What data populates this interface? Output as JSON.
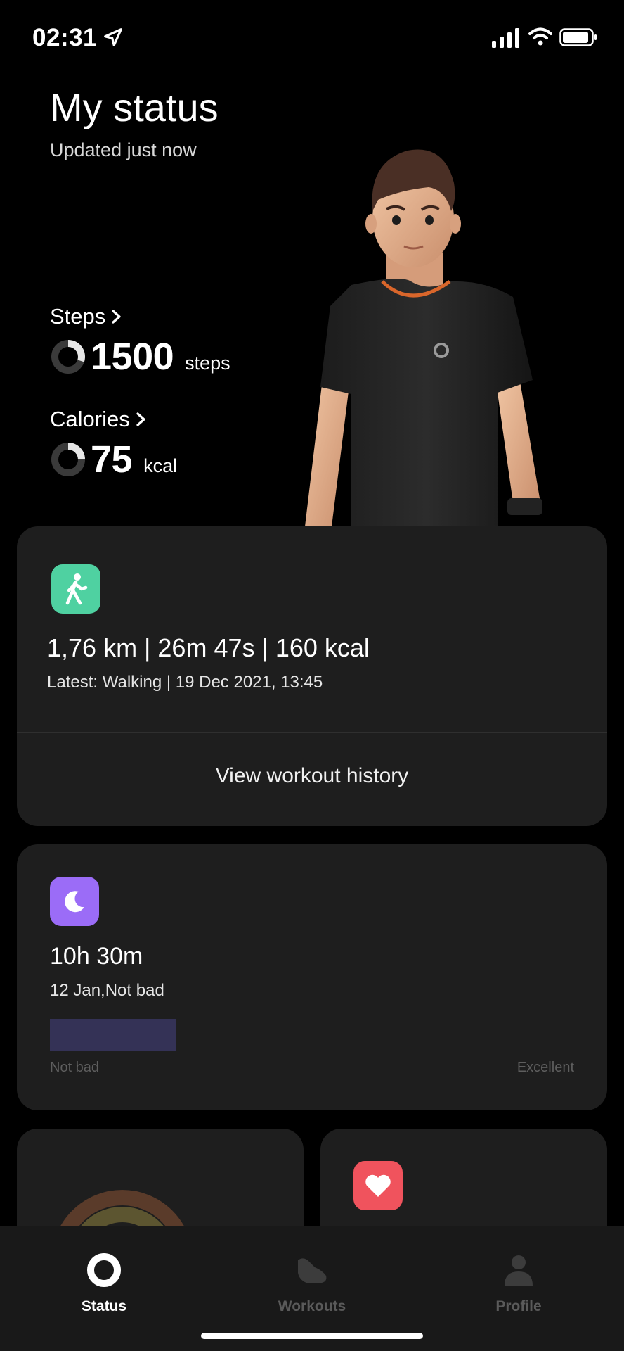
{
  "status_bar": {
    "time": "02:31"
  },
  "header": {
    "title": "My status",
    "subtitle": "Updated just now"
  },
  "steps": {
    "label": "Steps",
    "value": "1500",
    "unit": "steps",
    "progress": 0.3
  },
  "calories": {
    "label": "Calories",
    "value": "75",
    "unit": "kcal",
    "progress": 0.25
  },
  "workout": {
    "summary": "1,76 km | 26m 47s | 160 kcal",
    "latest": "Latest: Walking | 19 Dec 2021, 13:45",
    "view_history": "View workout history"
  },
  "sleep": {
    "duration": "10h 30m",
    "subtitle": "12 Jan,Not bad",
    "scale_low": "Not bad",
    "scale_high": "Excellent"
  },
  "nav": {
    "status": "Status",
    "workouts": "Workouts",
    "profile": "Profile"
  },
  "colors": {
    "workout_icon": "#4fd1a1",
    "sleep_icon": "#9b6cf7",
    "heart_icon": "#f0535d",
    "card_bg": "#1e1e1e"
  }
}
